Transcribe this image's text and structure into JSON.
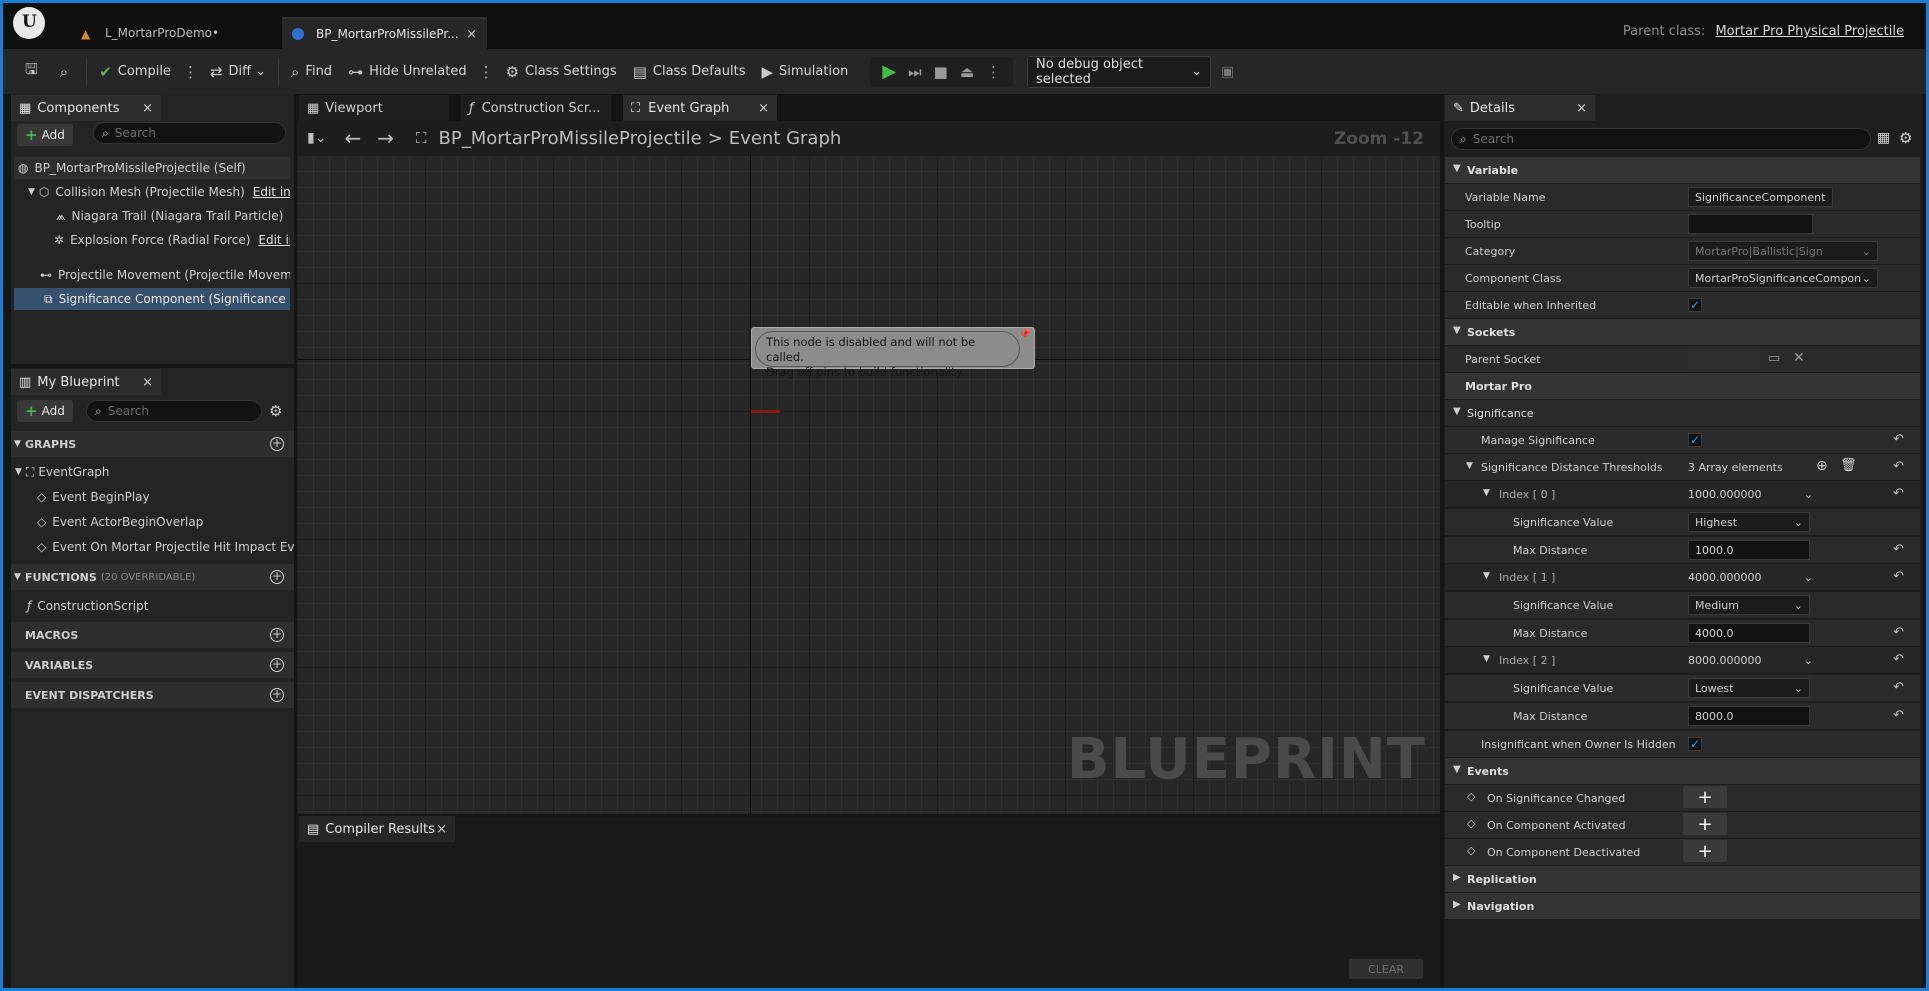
{
  "window": {
    "tabs": [
      {
        "label": "L_MortarProDemo•"
      },
      {
        "label": "BP_MortarProMissilePr...",
        "close": "×"
      }
    ],
    "parent_class_label": "Parent class:",
    "parent_class_value": "Mortar Pro Physical Projectile"
  },
  "toolbar": {
    "compile": "Compile",
    "diff": "Diff",
    "find": "Find",
    "hide_unrelated": "Hide Unrelated",
    "class_settings": "Class Settings",
    "class_defaults": "Class Defaults",
    "simulation": "Simulation",
    "debug_object": "No debug object selected"
  },
  "components": {
    "tab": "Components",
    "close": "×",
    "add": "Add",
    "search_placeholder": "Search",
    "items": [
      {
        "label": "BP_MortarProMissileProjectile (Self)"
      },
      {
        "label": "Collision Mesh (Projectile Mesh)",
        "edit": "Edit in"
      },
      {
        "label": "Niagara Trail (Niagara Trail Particle)",
        "edit": ""
      },
      {
        "label": "Explosion Force (Radial Force)",
        "edit": "Edit in"
      },
      {
        "label": "Projectile Movement (Projectile Movem"
      },
      {
        "label": "Significance Component (Significance C"
      }
    ]
  },
  "my_blueprint": {
    "tab": "My Blueprint",
    "close": "×",
    "add": "Add",
    "search_placeholder": "Search",
    "graphs_label": "GRAPHS",
    "event_graph": "EventGraph",
    "events": [
      "Event BeginPlay",
      "Event ActorBeginOverlap",
      "Event On Mortar Projectile Hit Impact Eve"
    ],
    "functions_label": "FUNCTIONS",
    "functions_note": "(20 OVERRIDABLE)",
    "construction_script": "ConstructionScript",
    "macros_label": "MACROS",
    "variables_label": "VARIABLES",
    "dispatchers_label": "EVENT DISPATCHERS"
  },
  "center_tabs": {
    "viewport": "Viewport",
    "construction": "Construction Scr...",
    "event_graph": "Event Graph",
    "close": "×"
  },
  "graph": {
    "breadcrumb_bp": "BP_MortarProMissileProjectile",
    "breadcrumb_sep": ">",
    "breadcrumb_graph": "Event Graph",
    "zoom": "Zoom -12",
    "node_comment_line1": "This node is disabled and will not be called.",
    "node_comment_line2": "Drag off pins to build functionality.",
    "watermark": "BLUEPRINT"
  },
  "compiler": {
    "tab": "Compiler Results",
    "close": "×",
    "clear": "CLEAR"
  },
  "details": {
    "tab": "Details",
    "close": "×",
    "search_placeholder": "Search",
    "variable_section": "Variable",
    "variable_name_label": "Variable Name",
    "variable_name_value": "SignificanceComponent",
    "tooltip_label": "Tooltip",
    "category_label": "Category",
    "category_value": "MortarPro|Ballistic|Sign",
    "component_class_label": "Component Class",
    "component_class_value": "MortarProSignificanceCompon",
    "editable_label": "Editable when Inherited",
    "sockets_section": "Sockets",
    "parent_socket_label": "Parent Socket",
    "mortar_pro_section": "Mortar Pro",
    "significance_section": "Significance",
    "manage_significance_label": "Manage Significance",
    "thresholds_label": "Significance Distance Thresholds",
    "thresholds_value": "3 Array elements",
    "indices": [
      {
        "label": "Index [ 0 ]",
        "value": "1000.000000",
        "sig_label": "Significance Value",
        "sig_value": "Highest",
        "max_label": "Max Distance",
        "max_value": "1000.0"
      },
      {
        "label": "Index [ 1 ]",
        "value": "4000.000000",
        "sig_label": "Significance Value",
        "sig_value": "Medium",
        "max_label": "Max Distance",
        "max_value": "4000.0"
      },
      {
        "label": "Index [ 2 ]",
        "value": "8000.000000",
        "sig_label": "Significance Value",
        "sig_value": "Lowest",
        "max_label": "Max Distance",
        "max_value": "8000.0"
      }
    ],
    "insignificant_label": "Insignificant when Owner Is Hidden",
    "events_section": "Events",
    "events": [
      "On Significance Changed",
      "On Component Activated",
      "On Component Deactivated"
    ],
    "replication_section": "Replication",
    "navigation_section": "Navigation"
  },
  "colors": {
    "accent_border": "#1a7fd4",
    "selection": "#37506e",
    "play_green": "#3fbf3f",
    "checkbox_blue": "#3e9ad6"
  }
}
